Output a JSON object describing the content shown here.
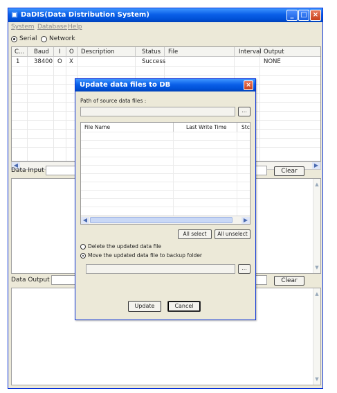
{
  "app": {
    "title": "DaDIS(Data Distribution System)"
  },
  "menu": {
    "items": [
      "System",
      "Database",
      "Help"
    ]
  },
  "connection": {
    "options": [
      "Serial",
      "Network"
    ],
    "selected": "Serial"
  },
  "grid": {
    "columns": [
      "C...",
      "Baud",
      "I",
      "O",
      "Description",
      "Status",
      "File",
      "Interval",
      "Output"
    ],
    "rows": [
      [
        "1",
        "38400",
        "O",
        "X",
        "",
        "Success",
        "",
        "",
        "NONE"
      ]
    ]
  },
  "data_input": {
    "label": "Data Input :",
    "clear_label": "Clear",
    "value": ""
  },
  "data_output": {
    "label": "Data Output :",
    "clear_label": "Clear",
    "value": ""
  },
  "dialog": {
    "title": "Update data files to DB",
    "path_label": "Path of source data files :",
    "path_value": "",
    "browse_label": "...",
    "columns": [
      "File Name",
      "Last Write Time",
      "Stc"
    ],
    "files": [],
    "select_all_label": "All select",
    "unselect_all_label": "All unselect",
    "options": [
      "Delete the updated data file",
      "Move the updated data file to backup folder"
    ],
    "selected_option": "Move the updated data file to backup folder",
    "backup_path_value": "",
    "update_label": "Update",
    "cancel_label": "Cancel"
  },
  "colors": {
    "title_blue": "#0a5fe8",
    "window_bg": "#ece9d8",
    "close_red": "#c7411c"
  }
}
